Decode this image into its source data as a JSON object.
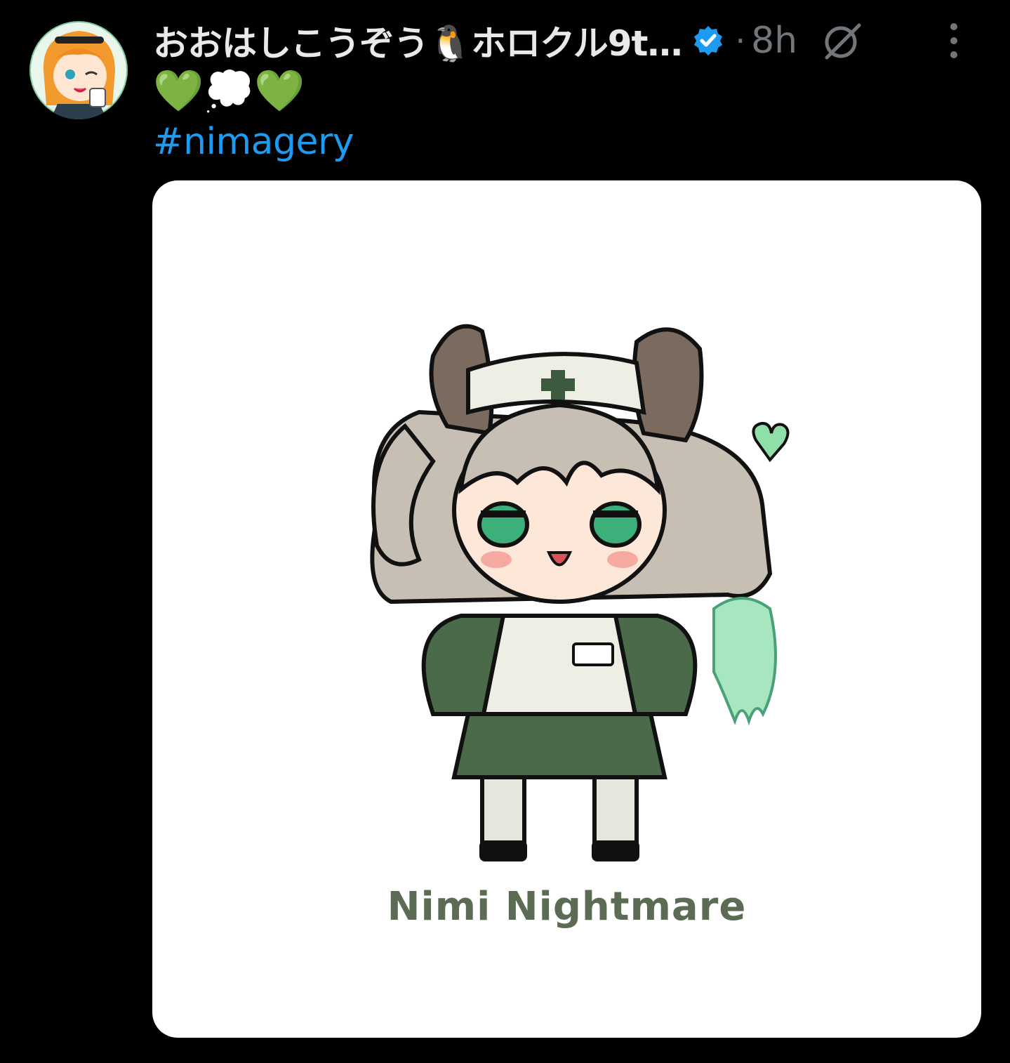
{
  "tweet": {
    "author": {
      "display_name": "おおはしこうぞう🐧ホロクル9t…",
      "verified": true,
      "avatar_icon": "avatar-anime-girl-orange-hair"
    },
    "separator": "·",
    "time": "8h",
    "text_emojis": "💚💭💚",
    "hashtag": "#nimagery",
    "media": {
      "caption": "Nimi Nightmare"
    }
  },
  "colors": {
    "background": "#000000",
    "text": "#e7e9ea",
    "muted": "#71767b",
    "link": "#1d9bf0",
    "verified": "#1d9bf0",
    "caption": "#5b6b54"
  },
  "icons": {
    "verified": "verified-badge-icon",
    "grok": "grok-icon",
    "more": "more-options-icon"
  }
}
